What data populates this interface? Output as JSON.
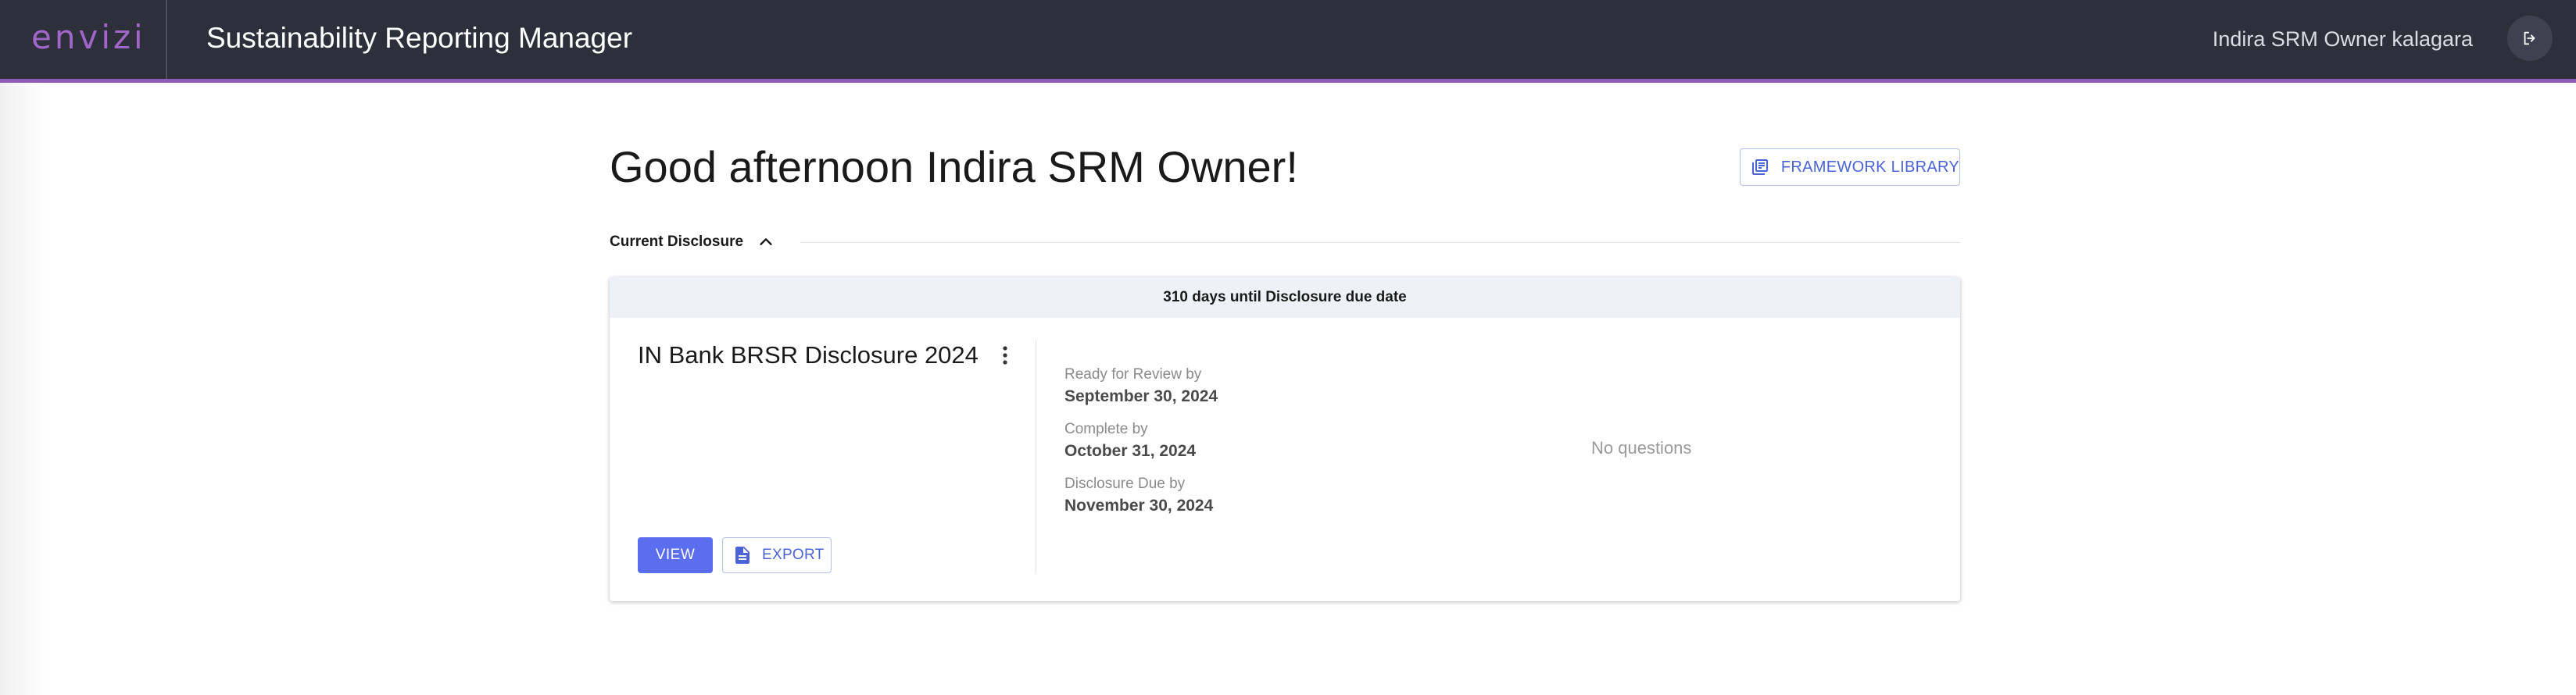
{
  "header": {
    "logo_text": "envizi",
    "app_title": "Sustainability Reporting Manager",
    "user_name": "Indira SRM Owner kalagara",
    "logout_icon": "logout-icon"
  },
  "main": {
    "greeting": "Good afternoon Indira SRM Owner!",
    "framework_library_label": "FRAMEWORK LIBRARY",
    "section_label": "Current Disclosure"
  },
  "card": {
    "banner": "310 days until Disclosure due date",
    "title": "IN Bank BRSR Disclosure 2024",
    "dates": [
      {
        "label": "Ready for Review by",
        "value": "September 30, 2024"
      },
      {
        "label": "Complete by",
        "value": "October 31, 2024"
      },
      {
        "label": "Disclosure Due by",
        "value": "November 30, 2024"
      }
    ],
    "no_questions": "No questions",
    "view_label": "VIEW",
    "export_label": "EXPORT"
  },
  "colors": {
    "header_bg": "#2d2f3b",
    "accent_purple": "#8e5cb8",
    "primary_blue": "#5b6ef0",
    "link_blue": "#4a63d6"
  }
}
